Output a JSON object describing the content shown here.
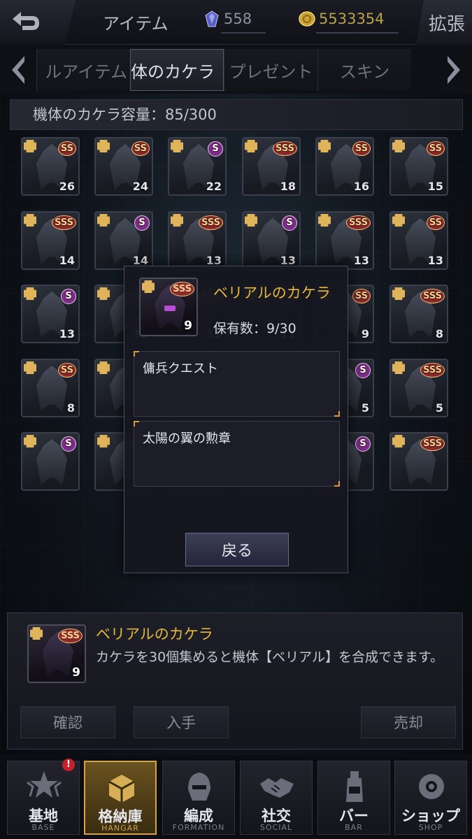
{
  "header": {
    "title": "アイテム",
    "gems": "558",
    "coins": "5533354",
    "expand_label": "拡張"
  },
  "tabs": [
    {
      "label": "ルアイテム",
      "active": false
    },
    {
      "label": "体のカケラ",
      "active": true
    },
    {
      "label": "プレゼント",
      "active": false
    },
    {
      "label": "スキン",
      "active": false
    }
  ],
  "capacity": {
    "label": "機体のカケラ容量：85/300"
  },
  "grid_items": [
    {
      "rank": "SS",
      "count": "26"
    },
    {
      "rank": "SS",
      "count": "24"
    },
    {
      "rank": "S",
      "count": "22"
    },
    {
      "rank": "SSS",
      "count": "18"
    },
    {
      "rank": "SS",
      "count": "16"
    },
    {
      "rank": "SS",
      "count": "15"
    },
    {
      "rank": "SSS",
      "count": "14"
    },
    {
      "rank": "S",
      "count": "14"
    },
    {
      "rank": "SSS",
      "count": "13"
    },
    {
      "rank": "S",
      "count": "13"
    },
    {
      "rank": "SSS",
      "count": "13"
    },
    {
      "rank": "SS",
      "count": "13"
    },
    {
      "rank": "S",
      "count": "13"
    },
    {
      "rank": "SSS",
      "count": "11"
    },
    {
      "rank": "SSS",
      "count": "11"
    },
    {
      "rank": "SS",
      "count": "11"
    },
    {
      "rank": "SS",
      "count": "9"
    },
    {
      "rank": "SSS",
      "count": "8"
    },
    {
      "rank": "SS",
      "count": "8"
    },
    {
      "rank": "S",
      "count": "6"
    },
    {
      "rank": "SS",
      "count": "6"
    },
    {
      "rank": "S",
      "count": "5"
    },
    {
      "rank": "S",
      "count": "5"
    },
    {
      "rank": "SSS",
      "count": "5"
    },
    {
      "rank": "S",
      "count": ""
    },
    {
      "rank": "SS",
      "count": ""
    },
    {
      "rank": "S",
      "count": ""
    },
    {
      "rank": "SSS",
      "count": ""
    },
    {
      "rank": "S",
      "count": ""
    },
    {
      "rank": "SSS",
      "count": ""
    }
  ],
  "popup": {
    "item_name": "ベリアルのカケラ",
    "rank": "SSS",
    "count": "9",
    "owned": "保有数：9/30",
    "sources": [
      "傭兵クエスト",
      "太陽の翼の勲章"
    ],
    "back_label": "戻る"
  },
  "detail": {
    "item_name": "ベリアルのカケラ",
    "rank": "SSS",
    "count": "9",
    "description": "カケラを30個集めると機体【ベリアル】を合成できます。",
    "buttons": {
      "confirm": "確認",
      "obtain": "入手",
      "sell": "売却"
    }
  },
  "nav": [
    {
      "label": "基地",
      "sub": "BASE",
      "icon": "base-emblem-icon",
      "badge": "!",
      "active": false
    },
    {
      "label": "格納庫",
      "sub": "HANGAR",
      "icon": "hangar-crate-icon",
      "active": true
    },
    {
      "label": "編成",
      "sub": "FORMATION",
      "icon": "formation-helmet-icon",
      "active": false
    },
    {
      "label": "社交",
      "sub": "SOCIAL",
      "icon": "handshake-icon",
      "active": false
    },
    {
      "label": "バー",
      "sub": "BAR",
      "icon": "bar-drink-icon",
      "active": false
    },
    {
      "label": "ショップ",
      "sub": "SHOP",
      "icon": "shop-bag-icon",
      "active": false
    }
  ],
  "colors": {
    "accent_gold": "#e5b83c",
    "background": "#0b0c12",
    "rank_ss": "#8a2a2a",
    "rank_s": "#7b2f8c"
  }
}
